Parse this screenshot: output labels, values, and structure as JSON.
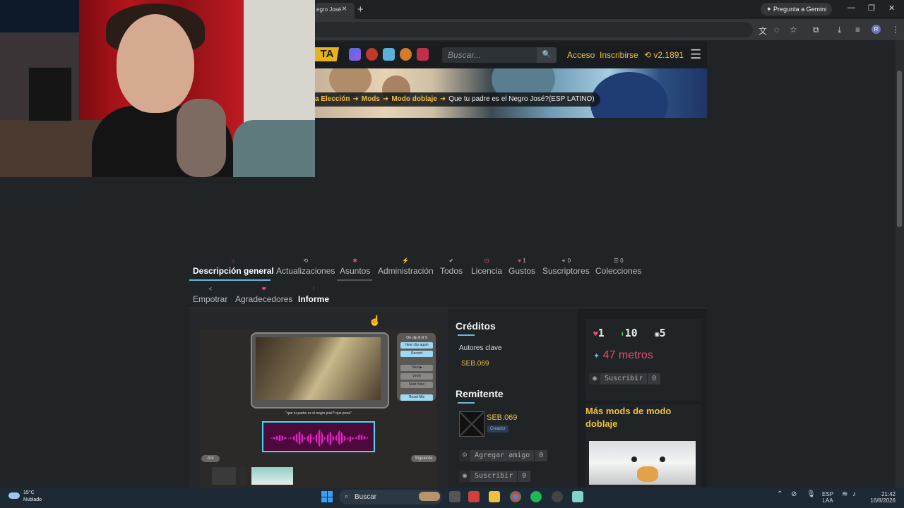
{
  "browser": {
    "tab_title": "egro José",
    "tab_close": "×",
    "new_tab": "+",
    "gemini_button": "Pregunta a Gemini",
    "profile_initial": "R"
  },
  "site": {
    "logo_text": "TA",
    "search_placeholder": "Buscar...",
    "nav_login": "Acceso",
    "nav_register": "Inscribirse",
    "version": "v2.1891",
    "breadcrumbs": [
      {
        "label": "a Elección"
      },
      {
        "label": "Mods"
      },
      {
        "label": "Modo doblaje"
      },
      {
        "label": "Que tu padre es el Negro José?(ESP LATINO)"
      }
    ],
    "tabs_row1": [
      {
        "label": "Descripción general",
        "count": ""
      },
      {
        "label": "Actualizaciones",
        "count": ""
      },
      {
        "label": "Asuntos",
        "count": ""
      },
      {
        "label": "Administración",
        "count": ""
      },
      {
        "label": "Todos",
        "count": ""
      },
      {
        "label": "Licencia",
        "count": ""
      },
      {
        "label": "Gustos",
        "count": "1"
      },
      {
        "label": "Suscriptores",
        "count": "0"
      },
      {
        "label": "Colecciones",
        "count": "0"
      }
    ],
    "tabs_row2": [
      {
        "label": "Empotrar"
      },
      {
        "label": "Agradecedores"
      },
      {
        "label": "Informe"
      }
    ]
  },
  "preview": {
    "clip_counter": "On clip 8 of 9",
    "buttons": [
      "Hear clip again",
      "Record",
      "Take ▶",
      "Verify",
      "Start Now",
      "Reset Mic"
    ],
    "caption": "\"que tu padre es el negro josé? que pena\"",
    "prev": "Ant",
    "next": "Siguiente"
  },
  "credits": {
    "title": "Créditos",
    "key_authors_label": "Autores clave",
    "author": "SEB.069",
    "submitter_title": "Remitente",
    "submitter_name": "SEB.069",
    "submitter_role": "Creador",
    "add_friend": "Agregar amigo",
    "add_friend_count": "0",
    "subscribe": "Suscribir",
    "subscribe_count": "0"
  },
  "stats": {
    "likes": "1",
    "downloads": "10",
    "subs": "5",
    "points": "47 metros",
    "subscribe": "Suscribir",
    "subscribe_count": "0"
  },
  "more_mods": {
    "title": "Más mods de modo doblaje"
  },
  "taskbar": {
    "temperature": "15°C",
    "weather": "Nublado",
    "search": "Buscar",
    "lang1": "ESP",
    "lang2": "LAA",
    "time": "21:42",
    "date": "16/8/2026"
  },
  "colors": {
    "accent_yellow": "#f0c040",
    "accent_blue": "#6ab7d8",
    "pink": "#e34c72"
  }
}
